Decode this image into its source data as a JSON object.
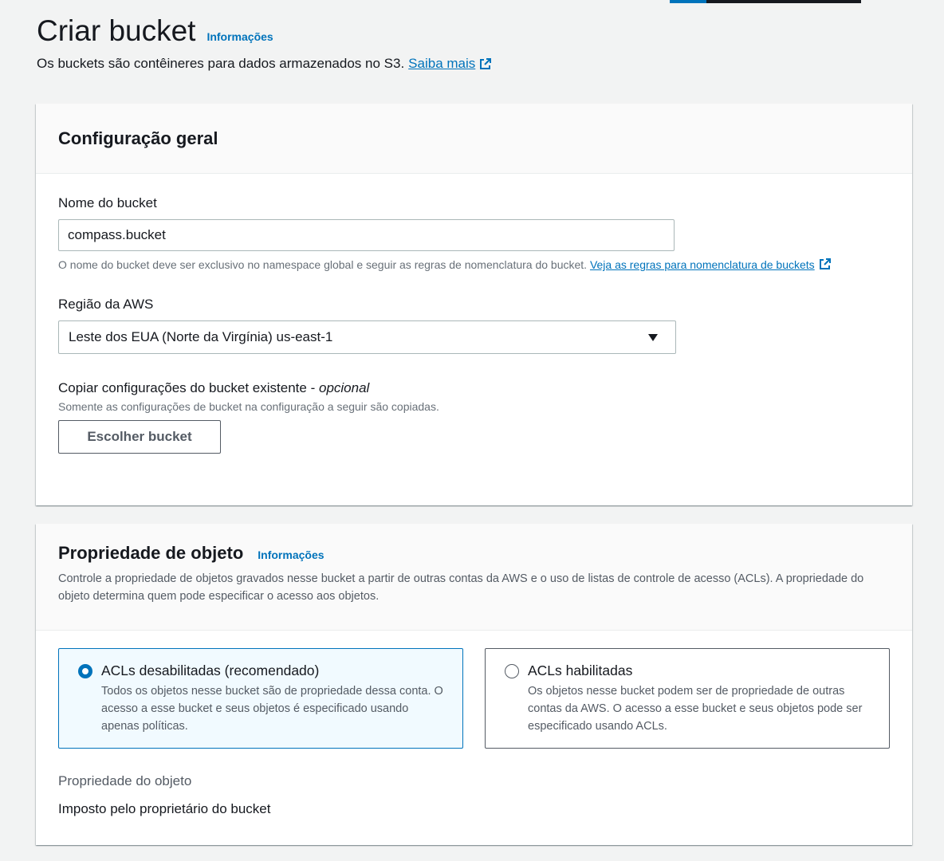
{
  "page": {
    "title": "Criar bucket",
    "info": "Informações",
    "description": "Os buckets são contêineres para dados armazenados no S3.",
    "learn_more": "Saiba mais"
  },
  "general": {
    "title": "Configuração geral",
    "bucket_name_label": "Nome do bucket",
    "bucket_name_value": "compass.bucket",
    "bucket_name_hint": "O nome do bucket deve ser exclusivo no namespace global e seguir as regras de nomenclatura do bucket.",
    "naming_rules_link": "Veja as regras para nomenclatura de buckets",
    "region_label": "Região da AWS",
    "region_value": "Leste dos EUA (Norte da Virgínia) us-east-1",
    "copy_label": "Copiar configurações do bucket existente -",
    "copy_optional": "opcional",
    "copy_hint": "Somente as configurações de bucket na configuração a seguir são copiadas.",
    "choose_button": "Escolher bucket"
  },
  "ownership": {
    "title": "Propriedade de objeto",
    "info": "Informações",
    "description": "Controle a propriedade de objetos gravados nesse bucket a partir de outras contas da AWS e o uso de listas de controle de acesso (ACLs). A propriedade do objeto determina quem pode especificar o acesso aos objetos.",
    "options": [
      {
        "label": "ACLs desabilitadas (recomendado)",
        "description": "Todos os objetos nesse bucket são de propriedade dessa conta. O acesso a esse bucket e seus objetos é especificado usando apenas políticas.",
        "selected": true
      },
      {
        "label": "ACLs habilitadas",
        "description": "Os objetos nesse bucket podem ser de propriedade de outras contas da AWS. O acesso a esse bucket e seus objetos pode ser especificado usando ACLs.",
        "selected": false
      }
    ],
    "result_label": "Propriedade do objeto",
    "result_value": "Imposto pelo proprietário do bucket"
  },
  "colors": {
    "link": "#0073bb",
    "selected_tile_bg": "#f1faff",
    "page_bg": "#f2f3f3"
  }
}
